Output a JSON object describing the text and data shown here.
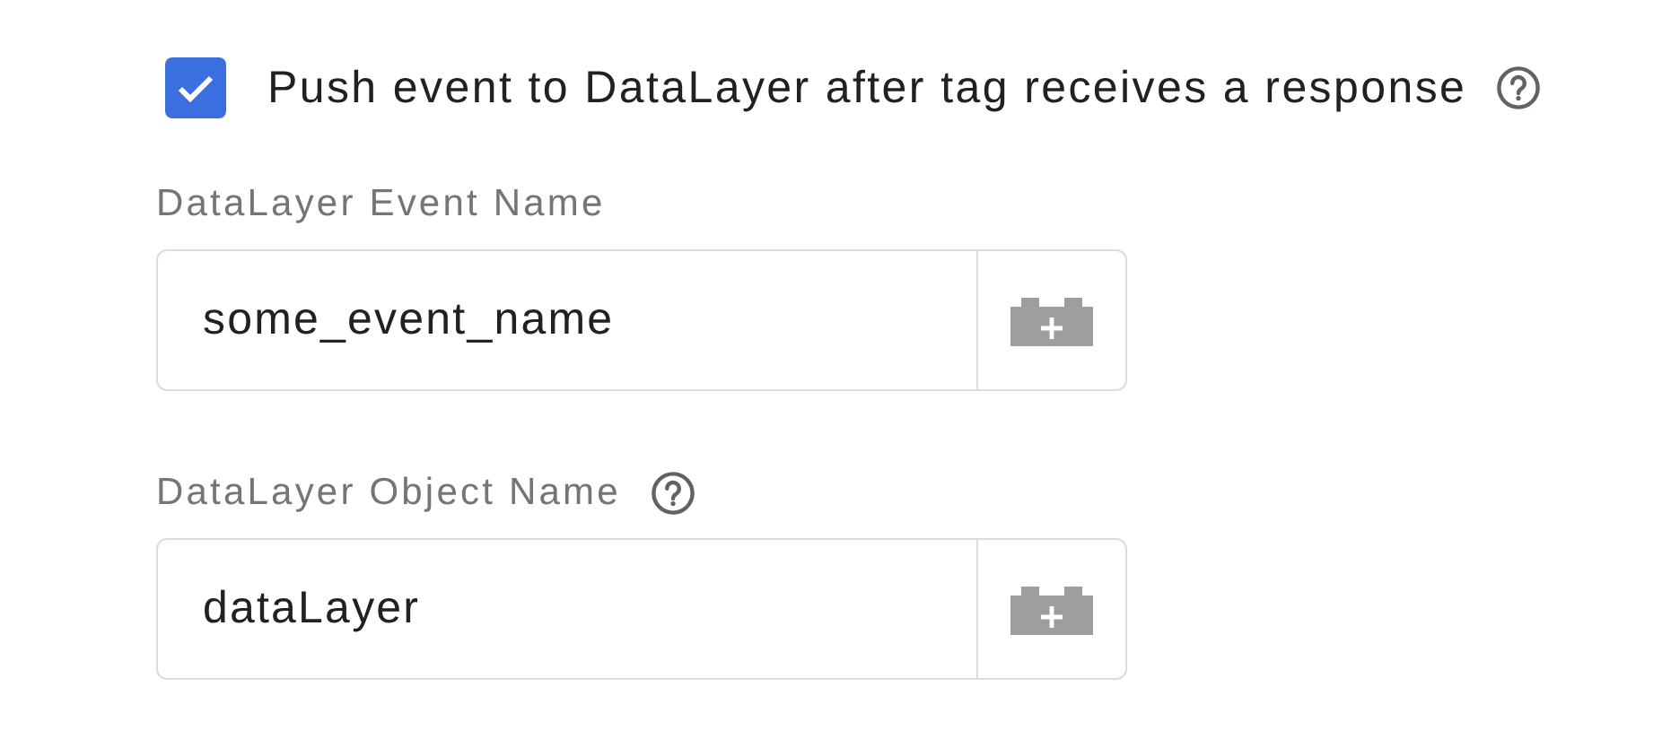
{
  "checkbox": {
    "label": "Push event to DataLayer after tag receives a response",
    "checked": true,
    "help": true
  },
  "fields": [
    {
      "label": "DataLayer Event Name",
      "value": "some_event_name",
      "help": false
    },
    {
      "label": "DataLayer Object Name",
      "value": "dataLayer",
      "help": true
    }
  ]
}
